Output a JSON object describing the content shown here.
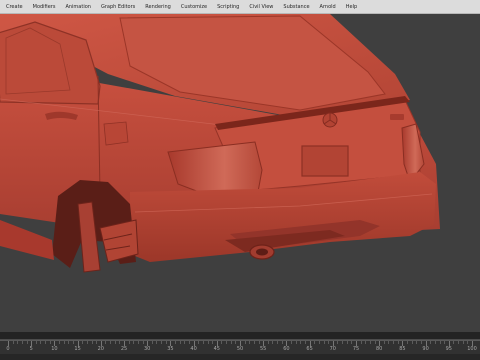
{
  "menu": {
    "items": [
      {
        "id": "create",
        "label": "Create"
      },
      {
        "id": "modifiers",
        "label": "Modifiers"
      },
      {
        "id": "animation",
        "label": "Animation"
      },
      {
        "id": "graph-editors",
        "label": "Graph Editors"
      },
      {
        "id": "rendering",
        "label": "Rendering"
      },
      {
        "id": "customize",
        "label": "Customize"
      },
      {
        "id": "scripting",
        "label": "Scripting"
      },
      {
        "id": "civil-view",
        "label": "Civil View"
      },
      {
        "id": "substance",
        "label": "Substance"
      },
      {
        "id": "arnold",
        "label": "Arnold"
      },
      {
        "id": "help",
        "label": "Help"
      }
    ]
  },
  "viewport": {
    "background_color": "#3f3f3f",
    "model_color": "#c24a3a",
    "model": "car-rear-three-quarter"
  },
  "timeline": {
    "frame_labels": [
      "0",
      "5",
      "10",
      "15",
      "20",
      "25",
      "30",
      "35",
      "40",
      "45",
      "50",
      "55",
      "60",
      "65",
      "70",
      "75",
      "80",
      "85",
      "90",
      "95",
      "100"
    ]
  }
}
